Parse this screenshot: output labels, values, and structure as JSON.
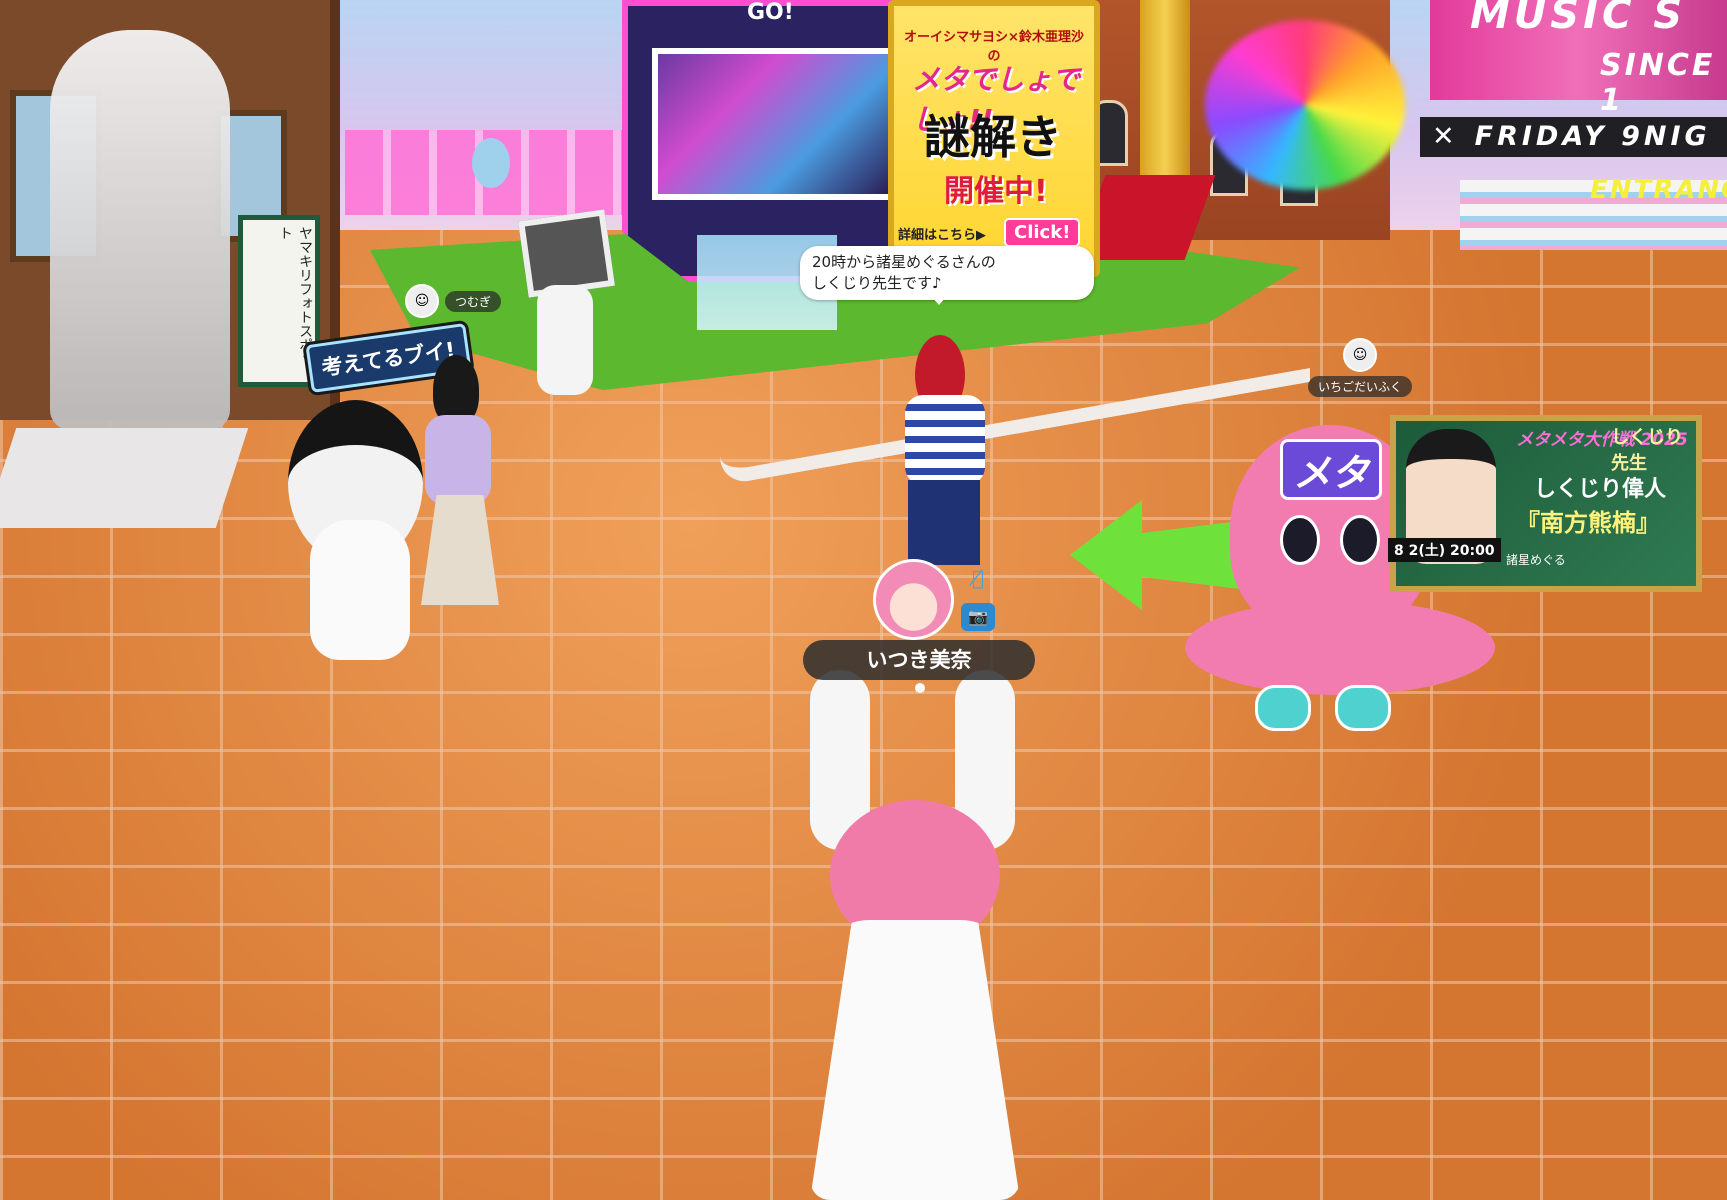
{
  "world": {
    "music_banner_line1": "MUSIC S",
    "music_banner_line2": "SINCE 1",
    "friday_bar": "FRIDAY 9NIG",
    "entrance": "ENTRANC"
  },
  "tower": {
    "go_label": "GO!"
  },
  "event_poster": {
    "title": "オーイシマサヨシ×鈴木亜理沙の",
    "catch": "メタでしょでしょ!!",
    "big": "謎解き",
    "status": "開催中!",
    "more": "詳細はこちら▶",
    "click": "Click!"
  },
  "speech_bubble": {
    "line1": "20時から諸星めぐるさんの",
    "line2": "しくじり先生です♪"
  },
  "signs": {
    "think": "考えてるブイ!",
    "photo_spot": "ヤマキリフォトスポット"
  },
  "vtuber_poster": {
    "title": "メタメタ大作戦 2025",
    "teacher": "しくじり先生",
    "line1": "しくじり偉人",
    "line2": "『南方熊楠』",
    "date": "8 2(土) 20:00",
    "host": "諸星めぐる"
  },
  "nametags": {
    "tsumugi": "つむぎ",
    "ichigo": "いちごだいふく"
  },
  "player": {
    "name": "いつき美奈",
    "mute_icon": "mic-muted-icon",
    "camera_icon": "camera-icon"
  },
  "octopus": {
    "label": "メタ"
  }
}
